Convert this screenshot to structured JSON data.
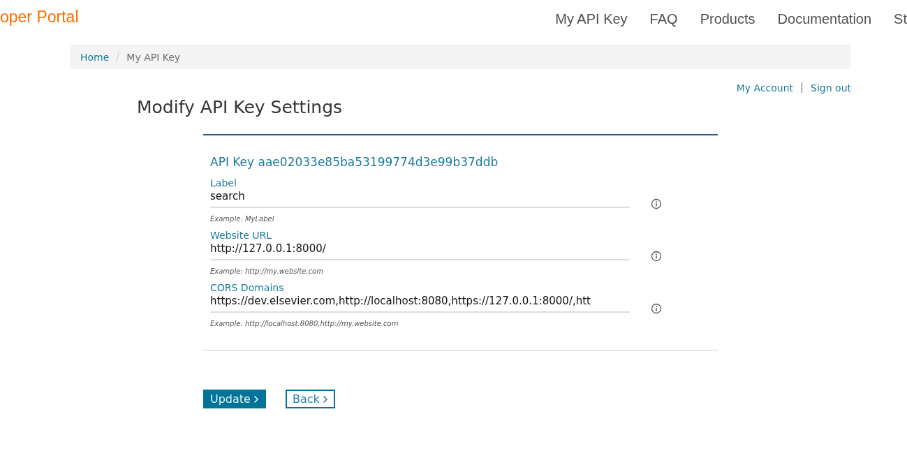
{
  "header": {
    "logo": "oper Portal",
    "nav": [
      {
        "label": "My API Key"
      },
      {
        "label": "FAQ"
      },
      {
        "label": "Products"
      },
      {
        "label": "Documentation"
      },
      {
        "label": "St"
      }
    ]
  },
  "breadcrumb": [
    {
      "label": "Home",
      "kind": "link"
    },
    {
      "label": "My API Key",
      "kind": "current"
    }
  ],
  "account_links": [
    "My Account",
    "Sign out"
  ],
  "title": "Modify API Key Settings",
  "api_key": "API Key aae02033e85ba53199774d3e99b37ddb",
  "fields": [
    {
      "label": "Label",
      "value": "search",
      "hint": "Example: MyLabel"
    },
    {
      "label": "Website URL",
      "value": "http://127.0.0.1:8000/",
      "hint": "Example: http://my.website.com"
    },
    {
      "label": "CORS Domains",
      "value": "https://dev.elsevier.com,http://localhost:8080,https://127.0.0.1:8000/,htt",
      "hint": "Example: http://localhost:8080,http://my.website.com"
    }
  ],
  "buttons": [
    {
      "label": "Update",
      "kind": "primary"
    },
    {
      "label": "Back",
      "kind": "secondary"
    }
  ]
}
